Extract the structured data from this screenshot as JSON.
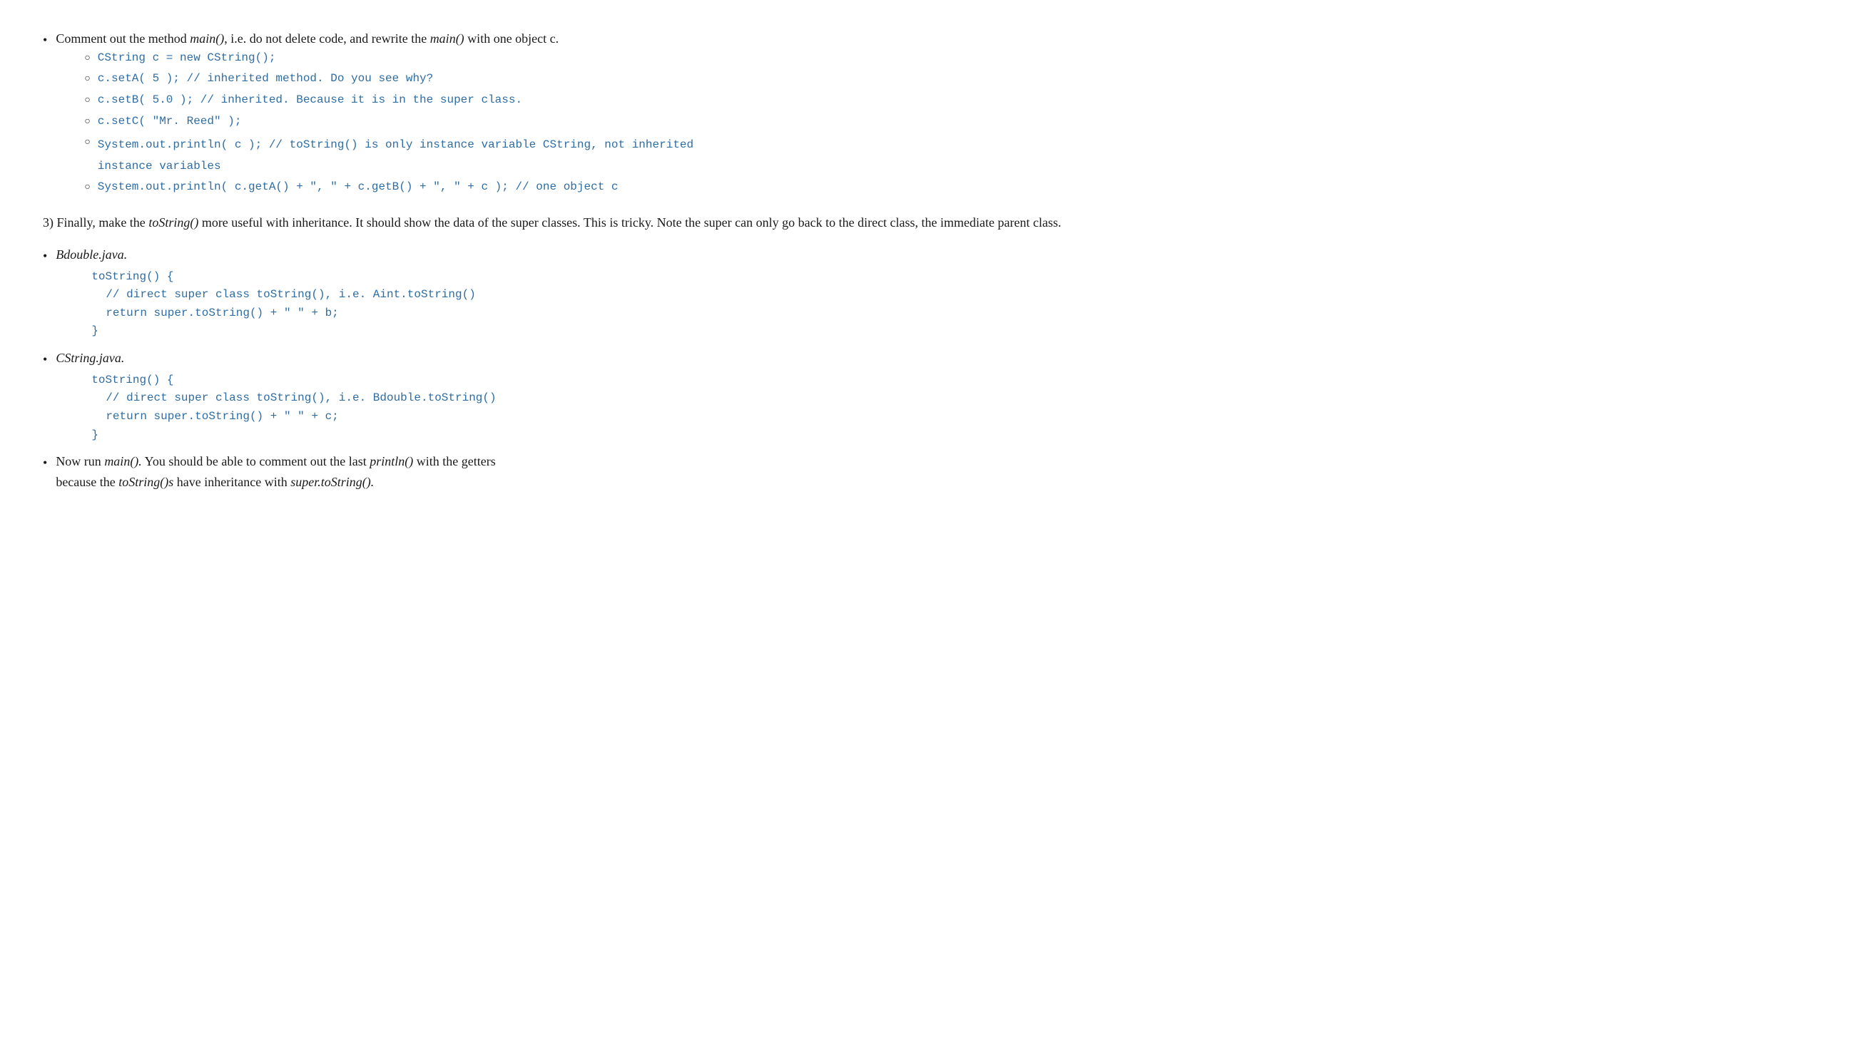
{
  "content": {
    "bullet1": {
      "text_before_italic1": "Comment out the method ",
      "italic1": "main()",
      "text_between": ", i.e. do not delete code, and rewrite the ",
      "italic2": "main()",
      "text_after": " with one object c.",
      "sub_items": [
        {
          "code": "CString c = new CString();"
        },
        {
          "code": "c.setA( 5 );",
          "comment": "   // inherited method. Do you see why?"
        },
        {
          "code": "c.setB( 5.0 );",
          "comment": "   // inherited. Because it is in the super class."
        },
        {
          "code": "c.setC( \"Mr. Reed\" );"
        },
        {
          "code": "System.out.println( c );",
          "comment": "  // toString() is only instance variable CString, not inherited"
        },
        {
          "code_continuation": "    instance variables"
        },
        {
          "code": "System.out.println( c.getA() + \", \" + c.getB() + \", \" + c );",
          "comment": "  // one object c"
        }
      ]
    },
    "section3": {
      "label": "3) Finally, make the ",
      "italic1": "toString()",
      "text_middle": " more useful with inheritance.  It should show the data of the super classes.  This is tricky.  Note the super can only go back to the direct class, the immediate parent class.",
      "bullets": [
        {
          "label_italic": "Bdouble.java.",
          "code_lines": [
            "toString() {",
            "  // direct super class toString(), i.e. Aint.toString()",
            "  return super.toString() + \"  \" + b;",
            "}"
          ]
        },
        {
          "label_italic": "CString.java.",
          "code_lines": [
            "toString() {",
            "  // direct super class toString(), i.e. Bdouble.toString()",
            "  return super.toString() + \"  \" + c;",
            "}"
          ]
        },
        {
          "label_before_italic": "Now run ",
          "label_italic": "main().",
          "label_after": "  You should be able to comment out the last ",
          "label_italic2": "println()",
          "label_after2": " with the getters",
          "line2_before": "because the ",
          "line2_italic": "toString()s",
          "line2_after": " have inheritance with ",
          "line2_italic2": "super.toString()."
        }
      ]
    }
  }
}
